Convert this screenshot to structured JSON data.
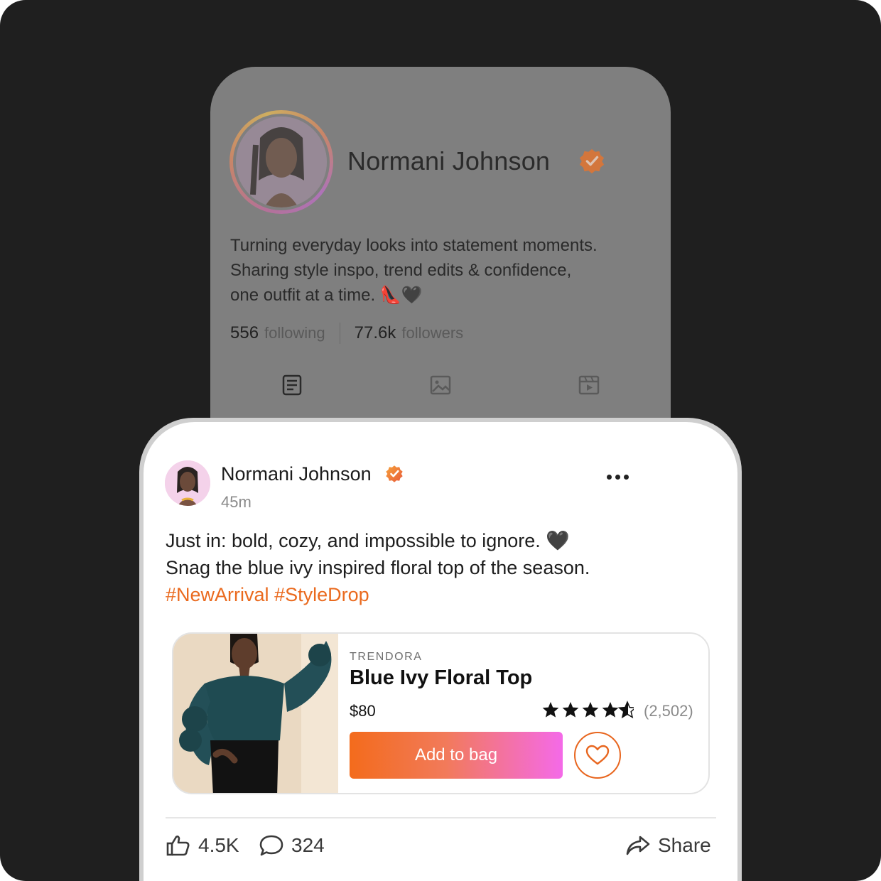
{
  "profile": {
    "name": "Normani Johnson",
    "bio_lines": [
      "Turning everyday looks into statement moments.",
      "Sharing style inspo, trend edits & confidence,",
      "one outfit at a time. 👠🖤"
    ],
    "following_count": "556",
    "following_label": "following",
    "followers_count": "77.6k",
    "followers_label": "followers",
    "tabs": [
      "posts-icon",
      "photos-icon",
      "videos-icon"
    ],
    "active_tab": "posts-icon"
  },
  "post": {
    "author": "Normani Johnson",
    "time": "45m",
    "caption_lines": [
      "Just in: bold, cozy, and impossible to ignore. 🖤",
      "Snag the blue ivy inspired floral top of the season."
    ],
    "hashtags": [
      "#NewArrival",
      "#StyleDrop"
    ],
    "product": {
      "brand": "TRENDORA",
      "title": "Blue Ivy Floral Top",
      "price": "$80",
      "rating": 4.5,
      "rating_count": "(2,502)",
      "add_label": "Add to bag"
    },
    "likes": "4.5K",
    "comments": "324",
    "share_label": "Share"
  },
  "colors": {
    "background": "#1f1f1f",
    "accent_orange": "#ea6a1e",
    "accent_pink": "#f46ae8",
    "verified_badge": "#f08a3a"
  }
}
